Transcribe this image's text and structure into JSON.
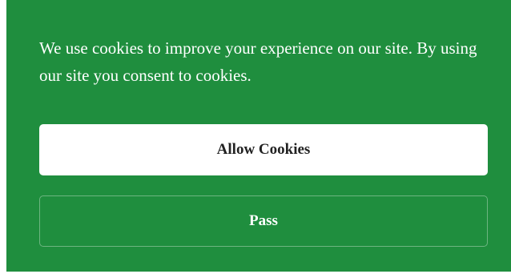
{
  "cookie_banner": {
    "message": "We use cookies to improve your experience on our site. By using our site you consent to cookies.",
    "allow_label": "Allow Cookies",
    "pass_label": "Pass",
    "colors": {
      "background": "#1f8e3e",
      "text": "#ffffff",
      "allow_button_bg": "#ffffff",
      "allow_button_text": "#222222"
    }
  }
}
